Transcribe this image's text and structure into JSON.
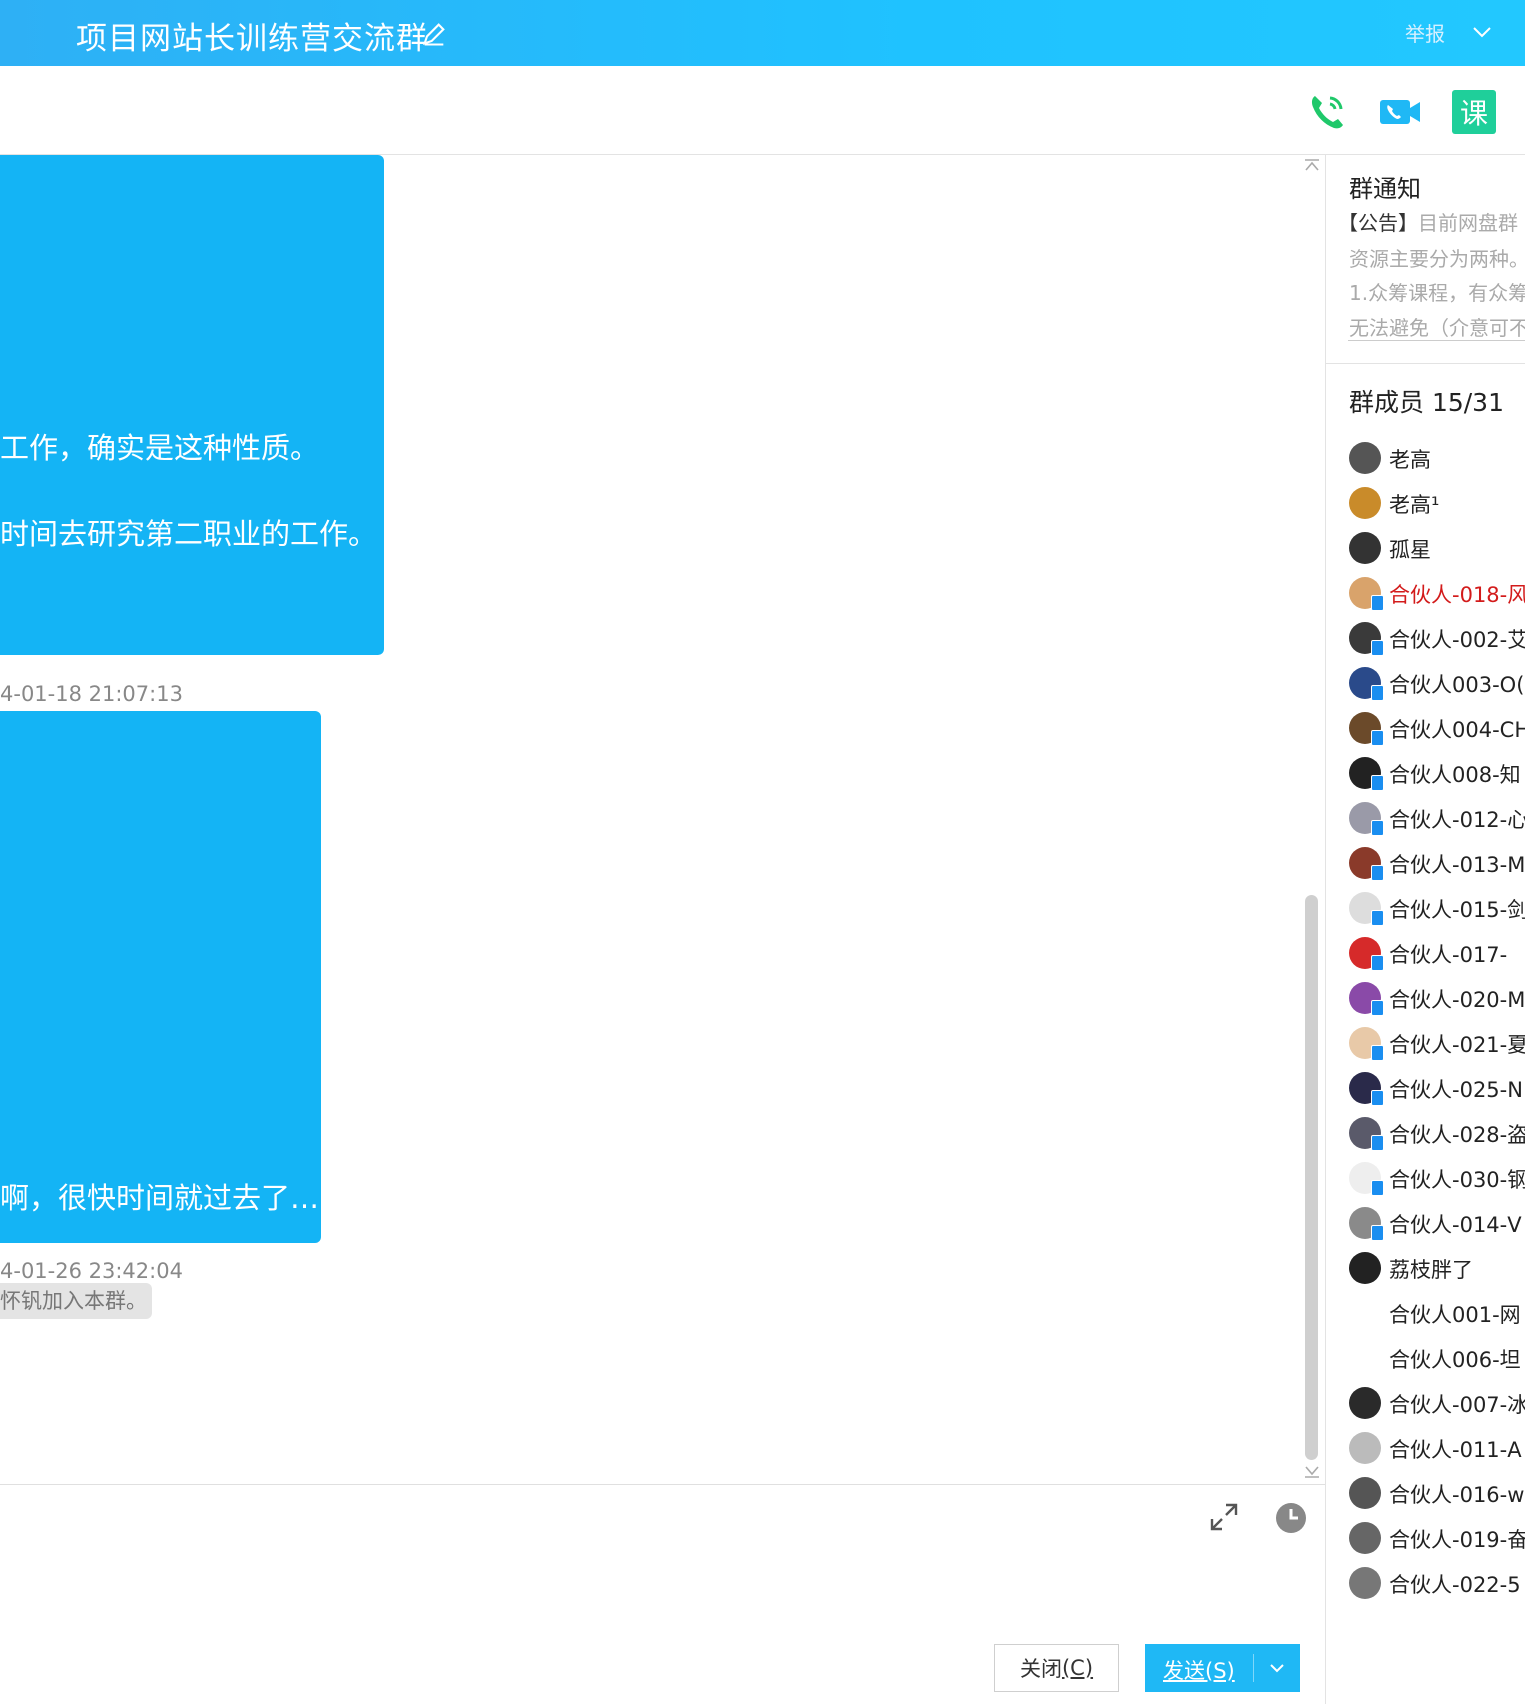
{
  "header": {
    "title": "项目网站长训练营交流群",
    "report_label": "举报"
  },
  "toolbar": {
    "icons": [
      "phone-call-icon",
      "video-call-icon",
      "course-icon"
    ],
    "course_label": "课"
  },
  "messages": [
    {
      "lines": [
        "工作，确实是这种性质。",
        "时间去研究第二职业的工作。"
      ]
    },
    {
      "timestamp": "4-01-18 21:07:13"
    },
    {
      "lines": [
        "啊，很快时间就过去了…"
      ]
    },
    {
      "timestamp": "4-01-26 23:42:04"
    },
    {
      "system": "怀钒加入本群。"
    }
  ],
  "input": {
    "close_label": "关闭",
    "close_key": "(C)",
    "send_label": "发送",
    "send_key": "(S)"
  },
  "notice": {
    "heading": "群通知",
    "tag": "【公告】",
    "lines": [
      "目前网盘群",
      "资源主要分为两种。",
      "1.众筹课程，有众筹",
      "无法避免（介意可不"
    ]
  },
  "members": {
    "heading": "群成员 15/31",
    "list": [
      {
        "name": "老高",
        "color": "#555555",
        "badge": false
      },
      {
        "name": "老高¹",
        "color": "#c98b2a",
        "badge": false
      },
      {
        "name": "孤星",
        "color": "#333333",
        "badge": false
      },
      {
        "name": "合伙人-018-风",
        "color": "#d9a36b",
        "badge": true,
        "highlight": "#d31b1b"
      },
      {
        "name": "合伙人-002-艾",
        "color": "#3a3a3a",
        "badge": true
      },
      {
        "name": "合伙人003-O(",
        "color": "#2a4a8a",
        "badge": true
      },
      {
        "name": "合伙人004-CH",
        "color": "#6b4a2a",
        "badge": true
      },
      {
        "name": "合伙人008-知",
        "color": "#222222",
        "badge": true
      },
      {
        "name": "合伙人-012-心",
        "color": "#9a9aa8",
        "badge": true
      },
      {
        "name": "合伙人-013-M",
        "color": "#8a3a2a",
        "badge": true
      },
      {
        "name": "合伙人-015-剑",
        "color": "#dddddd",
        "badge": true
      },
      {
        "name": "合伙人-017-",
        "color": "#d62a2a",
        "badge": true
      },
      {
        "name": "合伙人-020-M",
        "color": "#8a4aa8",
        "badge": true
      },
      {
        "name": "合伙人-021-夏",
        "color": "#e8c9a8",
        "badge": true
      },
      {
        "name": "合伙人-025-N",
        "color": "#2a2a4a",
        "badge": true
      },
      {
        "name": "合伙人-028-盗",
        "color": "#5a5a6a",
        "badge": true
      },
      {
        "name": "合伙人-030-钢",
        "color": "#eeeeee",
        "badge": true
      },
      {
        "name": "合伙人-014-V",
        "color": "#8a8a8a",
        "badge": true
      },
      {
        "name": "荔枝胖了",
        "color": "#222222",
        "badge": false
      },
      {
        "name": "合伙人001-网",
        "color": "#ffffff",
        "badge": false
      },
      {
        "name": "合伙人006-坦",
        "color": "#ffffff",
        "badge": false
      },
      {
        "name": "合伙人-007-冰",
        "color": "#2a2a2a",
        "badge": false
      },
      {
        "name": "合伙人-011-A",
        "color": "#bbbbbb",
        "badge": false
      },
      {
        "name": "合伙人-016-w",
        "color": "#555555",
        "badge": false
      },
      {
        "name": "合伙人-019-奋",
        "color": "#666666",
        "badge": false
      },
      {
        "name": "合伙人-022-5",
        "color": "#777777",
        "badge": false
      }
    ]
  }
}
